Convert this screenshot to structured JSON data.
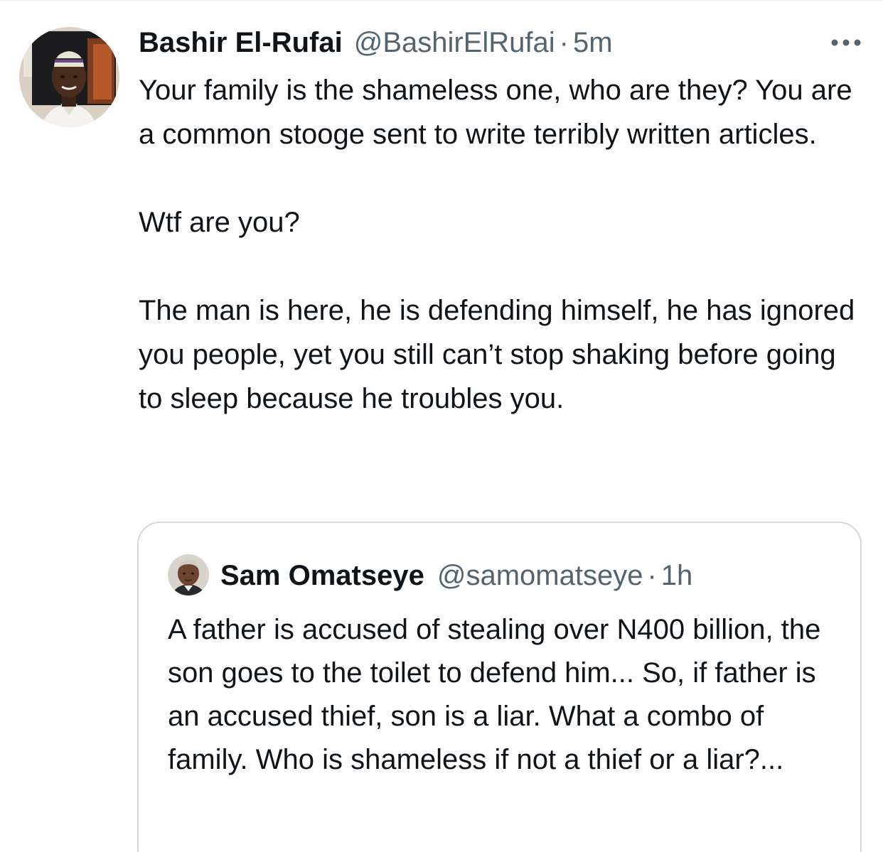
{
  "tweet": {
    "author_name": "Bashir El-Rufai",
    "author_handle": "@BashirElRufai",
    "separator": "·",
    "time": "5m",
    "more_icon": "more-horizontal-icon",
    "paragraphs": [
      "Your family is the shameless one, who are they? You are a common stooge sent to write terribly written articles.",
      "Wtf are you?",
      "The man is here, he is defending himself, he has ignored you people, yet you still can’t stop shaking before going to sleep because he troubles you."
    ]
  },
  "quoted_tweet": {
    "author_name": "Sam Omatseye",
    "author_handle": "@samomatseye",
    "separator": "·",
    "time": "1h",
    "text": "A father is accused of stealing over N400 billion, the son goes to the toilet to defend him... So, if father is an accused thief, son is a liar. What a combo of family.  Who is shameless if not a thief or a liar?..."
  },
  "colors": {
    "text_primary": "#0f1419",
    "text_secondary": "#536471",
    "border": "#cfd9de"
  }
}
